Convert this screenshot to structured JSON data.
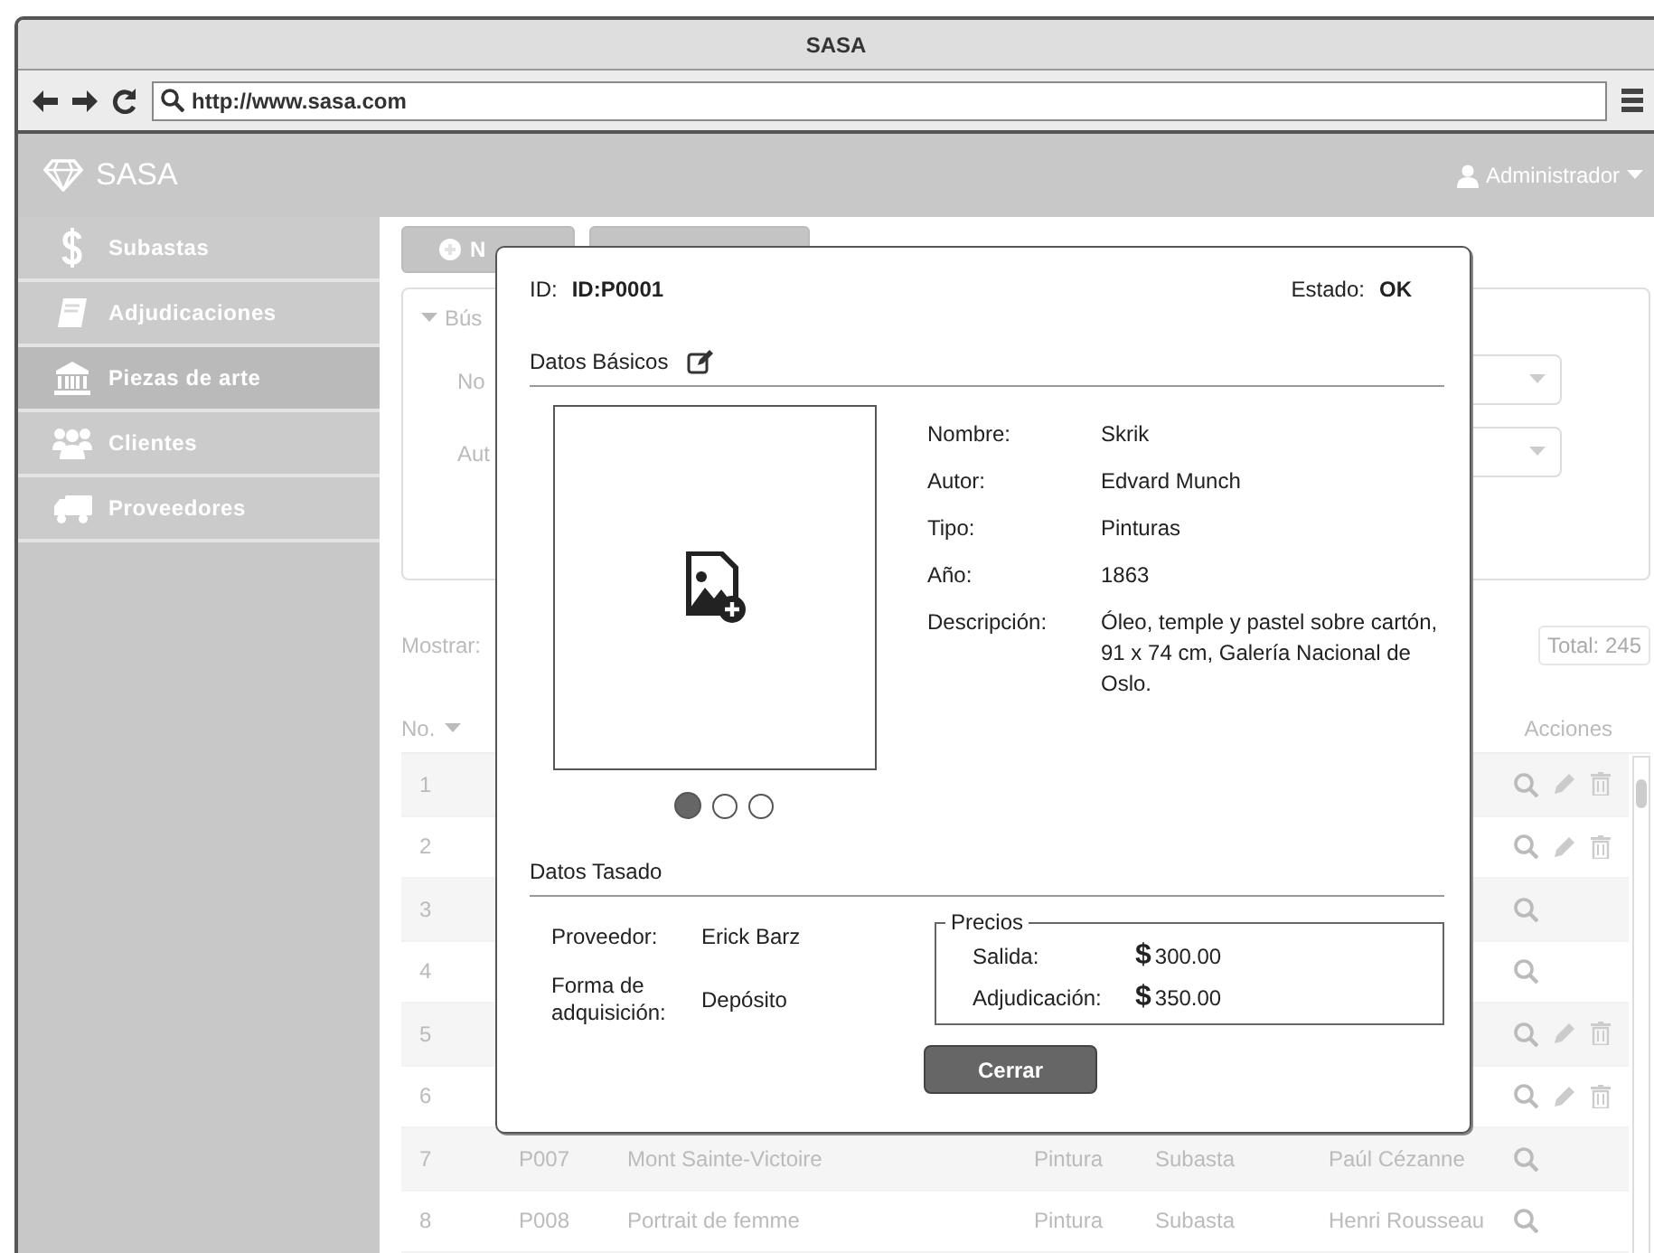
{
  "window": {
    "title": "SASA"
  },
  "browser": {
    "url": "http://www.sasa.com"
  },
  "header": {
    "brand": "SASA",
    "user": "Administrador"
  },
  "sidebar": {
    "items": [
      {
        "label": "Subastas",
        "selected": false
      },
      {
        "label": "Adjudicaciones",
        "selected": false
      },
      {
        "label": "Piezas de arte",
        "selected": true
      },
      {
        "label": "Clientes",
        "selected": false
      },
      {
        "label": "Proveedores",
        "selected": false
      }
    ]
  },
  "toolbar": {
    "new_button": "N"
  },
  "search_panel": {
    "title": "Bús",
    "fields": [
      {
        "label": "No"
      },
      {
        "label": "Aut"
      }
    ]
  },
  "list": {
    "show_label": "Mostrar:",
    "total": "Total: 245"
  },
  "table": {
    "columns": [
      {
        "label": "No.",
        "sorted": true
      },
      {
        "label": "Acciones",
        "sorted": false
      }
    ],
    "rows": [
      {
        "no": "1",
        "editable": true,
        "deletable": true
      },
      {
        "no": "2",
        "editable": true,
        "deletable": true
      },
      {
        "no": "3",
        "editable": false,
        "deletable": false
      },
      {
        "no": "4",
        "editable": false,
        "deletable": false
      },
      {
        "no": "5",
        "editable": true,
        "deletable": true
      },
      {
        "no": "6",
        "editable": true,
        "deletable": true
      },
      {
        "no": "7",
        "id": "P007",
        "name": "Mont Sainte-Victoire",
        "type": "Pintura",
        "status": "Subasta",
        "author": "Paúl Cézanne",
        "editable": false,
        "deletable": false
      },
      {
        "no": "8",
        "id": "P008",
        "name": "Portrait de femme",
        "type": "Pintura",
        "status": "Subasta",
        "author": "Henri Rousseau",
        "editable": false,
        "deletable": false
      }
    ]
  },
  "modal": {
    "id_label": "ID:",
    "id": "ID:P0001",
    "state_label": "Estado:",
    "state": "OK",
    "basic_title": "Datos Básicos",
    "details": [
      {
        "label": "Nombre:",
        "value": "Skrik"
      },
      {
        "label": "Autor:",
        "value": "Edvard Munch"
      },
      {
        "label": "Tipo:",
        "value": "Pinturas"
      },
      {
        "label": "Año:",
        "value": "1863"
      },
      {
        "label": "Descripción:",
        "value": "Óleo, temple y pastel sobre cartón, 91 x 74 cm, Galería Nacional de Oslo."
      }
    ],
    "slides": [
      {
        "selected": true
      },
      {
        "selected": false
      },
      {
        "selected": false
      }
    ],
    "appraisal_title": "Datos Tasado",
    "appraisal": [
      {
        "label": "Proveedor:",
        "value": "Erick Barz"
      },
      {
        "label": "Forma de adquisición:",
        "value": "Depósito"
      }
    ],
    "prices": {
      "title": "Precios",
      "items": [
        {
          "label": "Salida:",
          "currency": "$",
          "value": "300.00"
        },
        {
          "label": "Adjudicación:",
          "currency": "$",
          "value": "350.00"
        }
      ]
    },
    "close_button": "Cerrar"
  }
}
